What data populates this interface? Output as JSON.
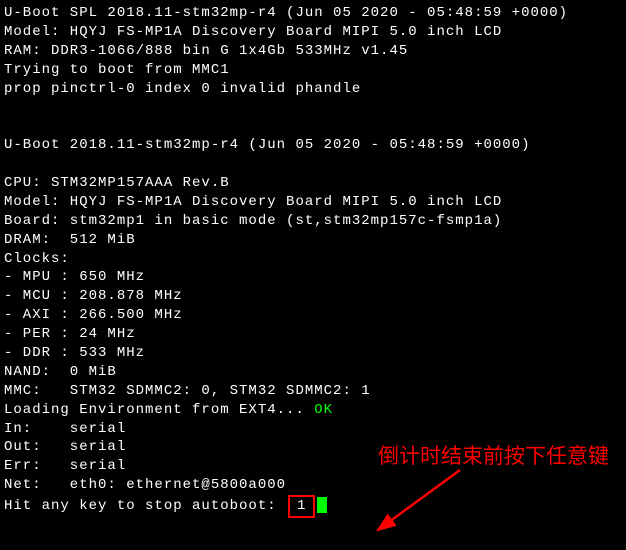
{
  "lines": {
    "l0": "U-Boot SPL 2018.11-stm32mp-r4 (Jun 05 2020 - 05:48:59 +0000)",
    "l1": "Model: HQYJ FS-MP1A Discovery Board MIPI 5.0 inch LCD",
    "l2": "RAM: DDR3-1066/888 bin G 1x4Gb 533MHz v1.45",
    "l3": "Trying to boot from MMC1",
    "l4": "prop pinctrl-0 index 0 invalid phandle",
    "l5": "",
    "l6": "",
    "l7": "U-Boot 2018.11-stm32mp-r4 (Jun 05 2020 - 05:48:59 +0000)",
    "l8": "",
    "l9": "CPU: STM32MP157AAA Rev.B",
    "l10": "Model: HQYJ FS-MP1A Discovery Board MIPI 5.0 inch LCD",
    "l11": "Board: stm32mp1 in basic mode (st,stm32mp157c-fsmp1a)",
    "l12": "DRAM:  512 MiB",
    "l13": "Clocks:",
    "l14": "- MPU : 650 MHz",
    "l15": "- MCU : 208.878 MHz",
    "l16": "- AXI : 266.500 MHz",
    "l17": "- PER : 24 MHz",
    "l18": "- DDR : 533 MHz",
    "l19": "NAND:  0 MiB",
    "l20": "MMC:   STM32 SDMMC2: 0, STM32 SDMMC2: 1",
    "l21_prefix": "Loading Environment from EXT4... ",
    "l21_ok": "OK",
    "l22": "In:    serial",
    "l23": "Out:   serial",
    "l24": "Err:   serial",
    "l25": "Net:   eth0: ethernet@5800a000",
    "l26_prefix": "Hit any key to stop autoboot: ",
    "countdown": "1"
  },
  "annotation": {
    "text": "倒计时结束前按下任意键"
  }
}
